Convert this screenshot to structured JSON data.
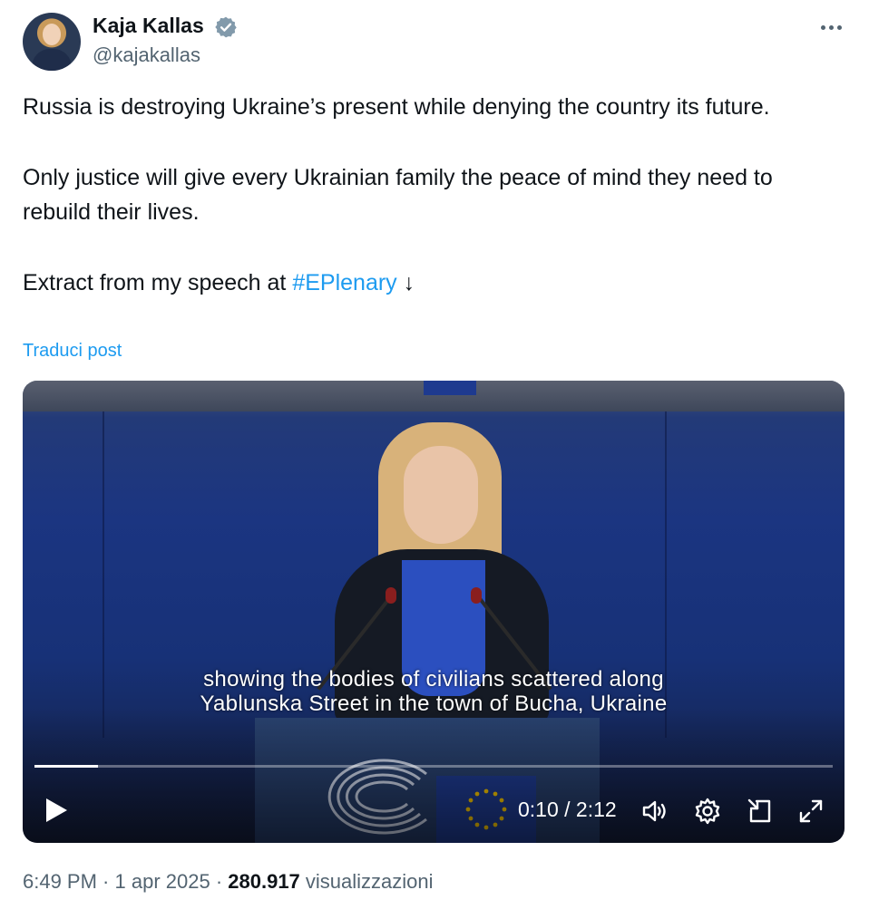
{
  "author": {
    "name": "Kaja Kallas",
    "handle": "@kajakallas"
  },
  "tweet": {
    "paragraphs": [
      "Russia is destroying Ukraine’s present while denying the country its future.",
      "Only justice will give every Ukrainian family the peace of mind they need to rebuild their lives."
    ],
    "extract_prefix": "Extract from my speech at ",
    "hashtag": "#EPlenary",
    "arrow": " ↓",
    "translate_label": "Traduci post"
  },
  "video": {
    "subtitle_line1": "showing the bodies of civilians scattered along",
    "subtitle_line2": "Yablunska Street in the town of Bucha, Ukraine",
    "time": "0:10 / 2:12",
    "progress": 0.08
  },
  "footer": {
    "time": "6:49 PM",
    "sep1": " · ",
    "date": "1 apr 2025",
    "sep2": " · ",
    "views": "280.917",
    "views_label": " visualizzazioni"
  },
  "colors": {
    "link": "#1d9bf0",
    "verified": "#829aab",
    "secondary_text": "#536471"
  },
  "icons": [
    "verified-badge-icon",
    "more-icon",
    "play-icon",
    "volume-icon",
    "settings-icon",
    "pip-icon",
    "fullscreen-icon"
  ]
}
